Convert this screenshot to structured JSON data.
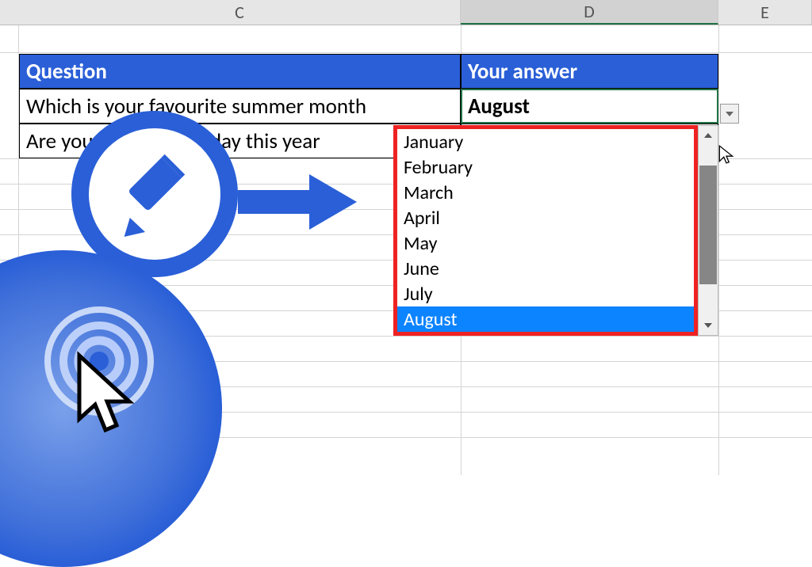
{
  "columns": {
    "C": "C",
    "D": "D",
    "E": "E"
  },
  "table": {
    "header": {
      "question": "Question",
      "answer": "Your answer"
    },
    "rows": [
      {
        "question": "Which is your favourite summer month",
        "answer": "August"
      },
      {
        "question": "Are you going on holiday this year",
        "answer": ""
      }
    ]
  },
  "dropdown": {
    "items": [
      "January",
      "February",
      "March",
      "April",
      "May",
      "June",
      "July",
      "August"
    ],
    "selected": "August"
  },
  "badge_icon": "pencil-icon",
  "logo_icon": "target-cursor-icon"
}
